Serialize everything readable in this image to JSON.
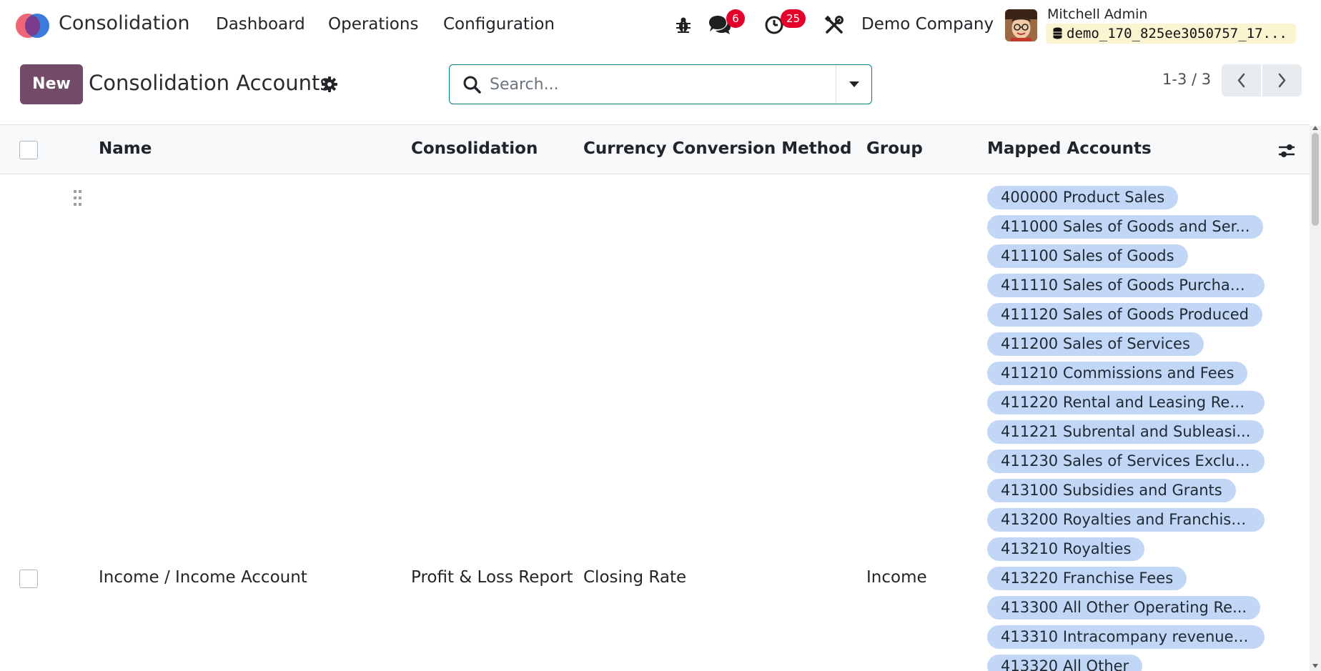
{
  "navbar": {
    "app_name": "Consolidation",
    "menu": [
      "Dashboard",
      "Operations",
      "Configuration"
    ],
    "messages_badge": "6",
    "activities_badge": "25",
    "company": "Demo Company",
    "user_name": "Mitchell Admin",
    "database": "demo_170_825ee3050757_17..."
  },
  "control_panel": {
    "new_label": "New",
    "title": "Consolidation Accounts",
    "search_placeholder": "Search...",
    "pager": "1-3 / 3"
  },
  "table": {
    "columns": [
      "Name",
      "Consolidation",
      "Currency Conversion Method",
      "Group",
      "Mapped Accounts"
    ],
    "rows": [
      {
        "name": "Income / Income Account",
        "consolidation": "Profit & Loss Report",
        "currency_conversion": "Closing Rate",
        "group": "Income",
        "mapped_accounts": [
          "400000 Product Sales",
          "411000 Sales of Goods and Ser...",
          "411100 Sales of Goods",
          "411110 Sales of Goods Purchas...",
          "411120 Sales of Goods Produced",
          "411200 Sales of Services",
          "411210 Commissions and Fees",
          "411220 Rental and Leasing Rev...",
          "411221 Subrental and Subleasi...",
          "411230 Sales of Services Exclud...",
          "413100 Subsidies and Grants",
          "413200 Royalties and Franchise...",
          "413210 Royalties",
          "413220 Franchise Fees",
          "413300 All Other Operating Re...",
          "413310 Intracompany revenue ...",
          "413320 All Other"
        ]
      }
    ]
  },
  "colors": {
    "primary": "#714b67",
    "search_border": "#017e84",
    "tag_bg": "#c2d6f5",
    "badge": "#e4002b"
  }
}
